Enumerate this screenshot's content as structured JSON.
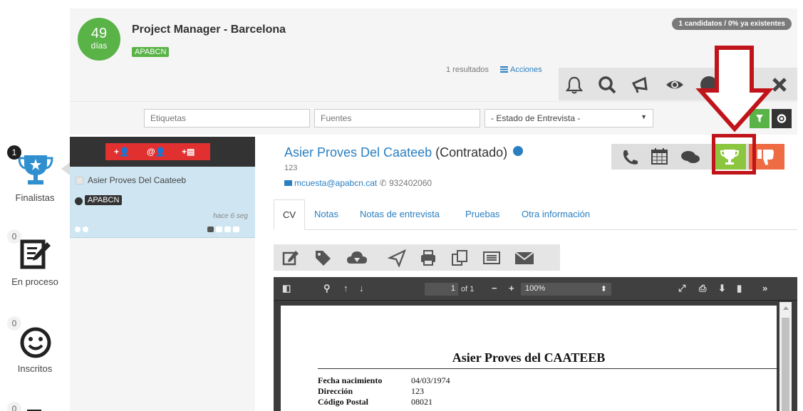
{
  "header": {
    "days_count": "49",
    "days_unit": "días",
    "job_title": "Project Manager - Barcelona",
    "job_tag": "APABCN",
    "candidates_badge": "1 candidatos / 0% ya existentes",
    "results_text": "1 resultados",
    "actions_label": "Acciones",
    "toolbar_icons": [
      "bell-icon",
      "search-icon",
      "megaphone-icon",
      "eye-icon",
      "info-icon",
      "user-icon",
      "close-icon"
    ]
  },
  "filters": {
    "tags_placeholder": "Etiquetas",
    "sources_placeholder": "Fuentes",
    "interview_status": "- Estado de Entrevista -"
  },
  "sidebar": {
    "stages": [
      {
        "count": "1",
        "label": "Finalistas",
        "icon": "trophy-icon"
      },
      {
        "count": "0",
        "label": "En proceso",
        "icon": "edit-document-icon"
      },
      {
        "count": "0",
        "label": "Inscritos",
        "icon": "smiley-icon"
      },
      {
        "count": "0",
        "label": "",
        "icon": "list-icon"
      }
    ]
  },
  "list": {
    "buttons": [
      "+👤",
      "@👤",
      "+▤"
    ],
    "candidate": {
      "name": "Asier Proves Del Caateeb",
      "tag": "APABCN",
      "time_ago": "hace 6 seg"
    }
  },
  "candidate": {
    "name": "Asier Proves Del Caateeb",
    "status": "(Contratado)",
    "id": "123",
    "email": "mcuesta@apabcn.cat",
    "phone": "932402060",
    "action_icons": [
      "phone-icon",
      "calendar-icon",
      "chat-icon",
      "trophy-icon",
      "thumbs-down-icon"
    ]
  },
  "tabs": [
    "CV",
    "Notas",
    "Notas de entrevista",
    "Pruebas",
    "Otra información"
  ],
  "doc_toolbar_icons": [
    "edit-icon",
    "tag-icon",
    "cloud-download-icon",
    "send-icon",
    "print-icon",
    "copy-icon",
    "list-icon",
    "envelope-icon"
  ],
  "pdf": {
    "page_current": "1",
    "page_total_label": "of 1",
    "zoom": "100%",
    "title": "Asier Proves del CAATEEB",
    "fields": [
      {
        "label": "Fecha nacimiento",
        "value": "04/03/1974"
      },
      {
        "label": "Dirección",
        "value": "123"
      },
      {
        "label": "Código Postal",
        "value": "08021"
      }
    ]
  },
  "colors": {
    "accent_blue": "#2a7fc1",
    "green": "#59b347",
    "red": "#e03030",
    "highlight_red": "#c0141a",
    "orange": "#ee6b43"
  }
}
